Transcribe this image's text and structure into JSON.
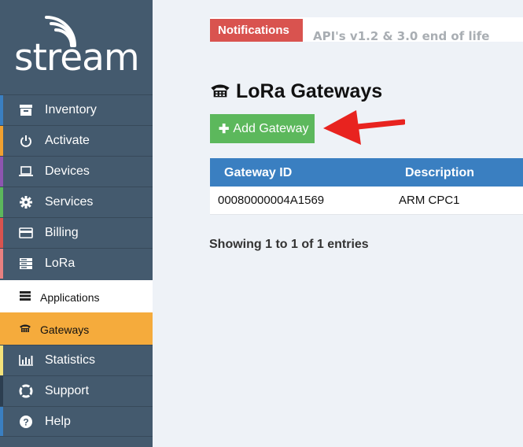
{
  "brand": {
    "name": "stream"
  },
  "sidebar": {
    "items": [
      {
        "label": "Inventory",
        "icon": "archive-icon",
        "accent": "#3a7fc1"
      },
      {
        "label": "Activate",
        "icon": "power-icon",
        "accent": "#f0a030"
      },
      {
        "label": "Devices",
        "icon": "laptop-icon",
        "accent": "#8e55b0"
      },
      {
        "label": "Services",
        "icon": "gear-icon",
        "accent": "#5cb85c"
      },
      {
        "label": "Billing",
        "icon": "credit-card-icon",
        "accent": "#d9534f"
      },
      {
        "label": "LoRa",
        "icon": "server-icon",
        "accent": "#e88080"
      }
    ],
    "sub_items": [
      {
        "label": "Applications",
        "icon": "server-icon",
        "active": false
      },
      {
        "label": "Gateways",
        "icon": "phone-icon",
        "active": true
      }
    ],
    "bottom_items": [
      {
        "label": "Statistics",
        "icon": "bar-chart-icon",
        "accent": "#f4e27a"
      },
      {
        "label": "Support",
        "icon": "lifebuoy-icon",
        "accent": "#2c3e50"
      },
      {
        "label": "Help",
        "icon": "question-icon",
        "accent": "#3a7fc1"
      }
    ]
  },
  "notifications": {
    "badge": "Notifications",
    "message": "API's v1.2 & 3.0 end of life"
  },
  "page": {
    "title": "LoRa Gateways",
    "add_button": "Add Gateway"
  },
  "table": {
    "columns": [
      "Gateway ID",
      "Description"
    ],
    "rows": [
      [
        "00080000004A1569",
        "ARM CPC1"
      ]
    ]
  },
  "table_info": "Showing 1 to 1 of 1 entries",
  "colors": {
    "sidebar_bg": "#445a6e",
    "active_item_bg": "#f5ab3c",
    "header_blue": "#3a7fc1",
    "button_green": "#5cb85c",
    "badge_red": "#d9534f",
    "arrow_red": "#e8231f"
  }
}
